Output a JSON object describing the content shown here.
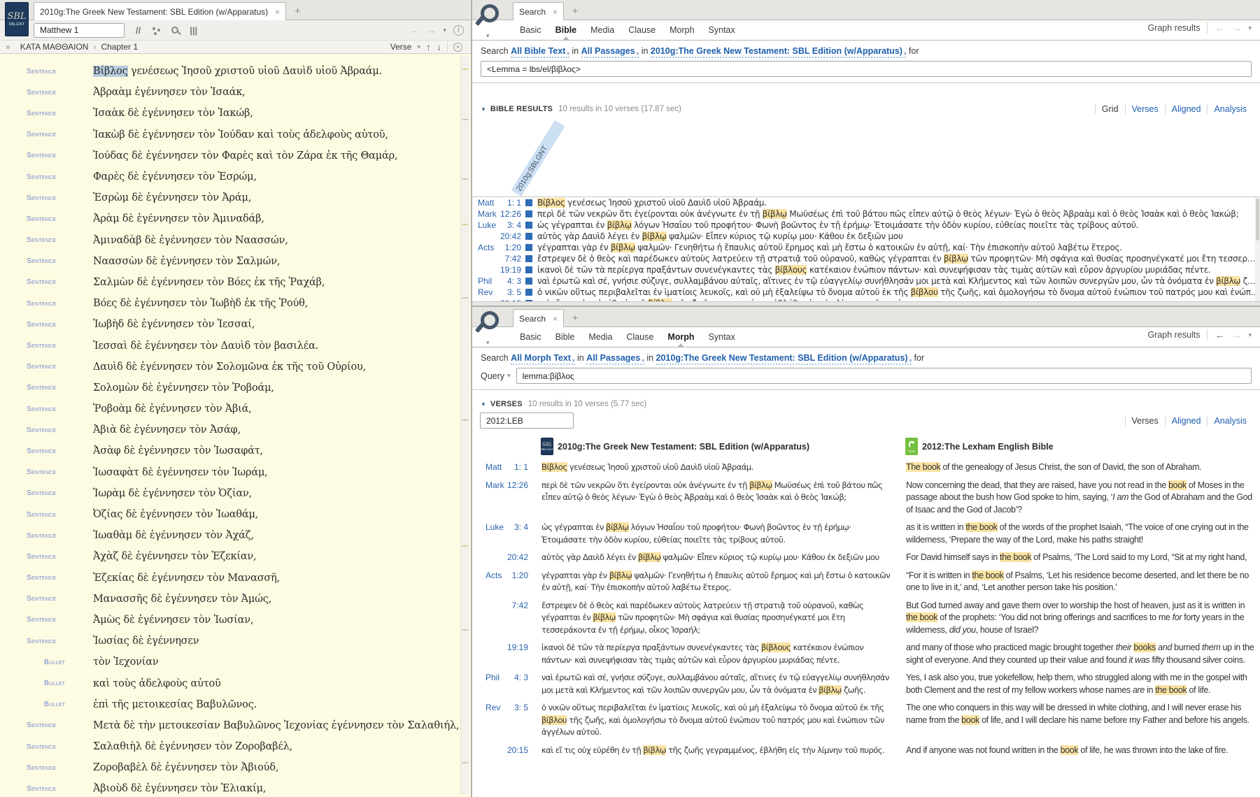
{
  "icons": {
    "close": "×",
    "add": "+",
    "caret": "▾",
    "back": "←",
    "forward": "→",
    "up": "↑",
    "down": "↓",
    "double_chevron": "»",
    "crumb": "›",
    "collapse": "▼",
    "parallel": "//",
    "columns": "|||",
    "info": "i"
  },
  "colors": {
    "hl": "#fae3a2",
    "sel": "#b7cdde",
    "link": "#1d5fad",
    "ref": "#2a62ad",
    "marker": "#2e6cb5",
    "leb": "#74bf3e",
    "navy": "#1d3a5e",
    "cream": "#fdfbe2",
    "label": "#7282cc"
  },
  "left_panel": {
    "tab_title": "2010g:The Greek New Testament: SBL Edition (w/Apparatus)",
    "logo": {
      "script": "SBL",
      "caption": "SBLGNT"
    },
    "reference_box": "Matthew 1",
    "locator": {
      "book": "ΚΑΤΑ ΜΑΘΘΑΙΟΝ",
      "chapter": "Chapter 1",
      "view_mode": "Verse"
    },
    "rows": [
      {
        "kind": "sentence",
        "label": "Sentence",
        "segments": [
          {
            "t": "Βίβλος",
            "sel": true
          },
          {
            "t": " γενέσεως Ἰησοῦ χριστοῦ υἱοῦ Δαυὶδ υἱοῦ Ἀβραάμ."
          }
        ]
      },
      {
        "kind": "sentence",
        "label": "Sentence",
        "segments": [
          {
            "t": "Ἀβραὰμ ἐγέννησεν τὸν Ἰσαάκ,"
          }
        ]
      },
      {
        "kind": "sentence",
        "label": "Sentence",
        "segments": [
          {
            "t": "Ἰσαὰκ δὲ ἐγέννησεν τὸν Ἰακώβ,"
          }
        ]
      },
      {
        "kind": "sentence",
        "label": "Sentence",
        "segments": [
          {
            "t": "Ἰακὼβ δὲ ἐγέννησεν τὸν Ἰούδαν καὶ τοὺς ἀδελφοὺς αὐτοῦ,"
          }
        ]
      },
      {
        "kind": "sentence",
        "label": "Sentence",
        "segments": [
          {
            "t": "Ἰούδας δὲ ἐγέννησεν τὸν Φαρὲς καὶ τὸν Ζάρα ἐκ τῆς Θαμάρ,"
          }
        ]
      },
      {
        "kind": "sentence",
        "label": "Sentence",
        "segments": [
          {
            "t": "Φαρὲς δὲ ἐγέννησεν τὸν Ἑσρώμ,"
          }
        ]
      },
      {
        "kind": "sentence",
        "label": "Sentence",
        "segments": [
          {
            "t": "Ἑσρὼμ δὲ ἐγέννησεν τὸν Ἀράμ,"
          }
        ]
      },
      {
        "kind": "sentence",
        "label": "Sentence",
        "segments": [
          {
            "t": "Ἀρὰμ δὲ ἐγέννησεν τὸν Ἀμιναδάβ,"
          }
        ]
      },
      {
        "kind": "sentence",
        "label": "Sentence",
        "segments": [
          {
            "t": "Ἀμιναδὰβ δὲ ἐγέννησεν τὸν Ναασσών,"
          }
        ]
      },
      {
        "kind": "sentence",
        "label": "Sentence",
        "segments": [
          {
            "t": "Ναασσὼν δὲ ἐγέννησεν τὸν Σαλμών,"
          }
        ]
      },
      {
        "kind": "sentence",
        "label": "Sentence",
        "segments": [
          {
            "t": "Σαλμὼν δὲ ἐγέννησεν τὸν Βόες ἐκ τῆς Ῥαχάβ,"
          }
        ]
      },
      {
        "kind": "sentence",
        "label": "Sentence",
        "segments": [
          {
            "t": "Βόες δὲ ἐγέννησεν τὸν Ἰωβὴδ ἐκ τῆς Ῥούθ,"
          }
        ]
      },
      {
        "kind": "sentence",
        "label": "Sentence",
        "segments": [
          {
            "t": "Ἰωβὴδ δὲ ἐγέννησεν τὸν Ἰεσσαί,"
          }
        ]
      },
      {
        "kind": "sentence",
        "label": "Sentence",
        "segments": [
          {
            "t": "Ἰεσσαὶ δὲ ἐγέννησεν τὸν Δαυὶδ τὸν βασιλέα."
          }
        ]
      },
      {
        "kind": "sentence",
        "label": "Sentence",
        "segments": [
          {
            "t": "Δαυὶδ δὲ ἐγέννησεν τὸν Σολομῶνα ἐκ τῆς τοῦ Οὐρίου,"
          }
        ]
      },
      {
        "kind": "sentence",
        "label": "Sentence",
        "segments": [
          {
            "t": "Σολομὼν δὲ ἐγέννησεν τὸν Ῥοβοάμ,"
          }
        ]
      },
      {
        "kind": "sentence",
        "label": "Sentence",
        "segments": [
          {
            "t": "Ῥοβοὰμ δὲ ἐγέννησεν τὸν Ἀβιά,"
          }
        ]
      },
      {
        "kind": "sentence",
        "label": "Sentence",
        "segments": [
          {
            "t": "Ἀβιὰ δὲ ἐγέννησεν τὸν Ἀσάφ,"
          }
        ]
      },
      {
        "kind": "sentence",
        "label": "Sentence",
        "segments": [
          {
            "t": "Ἀσὰφ δὲ ἐγέννησεν τὸν Ἰωσαφάτ,"
          }
        ]
      },
      {
        "kind": "sentence",
        "label": "Sentence",
        "segments": [
          {
            "t": "Ἰωσαφὰτ δὲ ἐγέννησεν τὸν Ἰωράμ,"
          }
        ]
      },
      {
        "kind": "sentence",
        "label": "Sentence",
        "segments": [
          {
            "t": "Ἰωρὰμ δὲ ἐγέννησεν τὸν Ὀζίαν,"
          }
        ]
      },
      {
        "kind": "sentence",
        "label": "Sentence",
        "segments": [
          {
            "t": "Ὀζίας δὲ ἐγέννησεν τὸν Ἰωαθάμ,"
          }
        ]
      },
      {
        "kind": "sentence",
        "label": "Sentence",
        "segments": [
          {
            "t": "Ἰωαθὰμ δὲ ἐγέννησεν τὸν Ἀχάζ,"
          }
        ]
      },
      {
        "kind": "sentence",
        "label": "Sentence",
        "segments": [
          {
            "t": "Ἀχὰζ δὲ ἐγέννησεν τὸν Ἑζεκίαν,"
          }
        ]
      },
      {
        "kind": "sentence",
        "label": "Sentence",
        "segments": [
          {
            "t": "Ἑζεκίας δὲ ἐγέννησεν τὸν Μανασσῆ,"
          }
        ]
      },
      {
        "kind": "sentence",
        "label": "Sentence",
        "segments": [
          {
            "t": "Μανασσῆς δὲ ἐγέννησεν τὸν Ἀμώς,"
          }
        ]
      },
      {
        "kind": "sentence",
        "label": "Sentence",
        "segments": [
          {
            "t": "Ἀμὼς δὲ ἐγέννησεν τὸν Ἰωσίαν,"
          }
        ]
      },
      {
        "kind": "sentence",
        "label": "Sentence",
        "segments": [
          {
            "t": "Ἰωσίας δὲ ἐγέννησεν"
          }
        ]
      },
      {
        "kind": "bullet",
        "label": "Bullet",
        "segments": [
          {
            "t": "τὸν Ἰεχονίαν"
          }
        ]
      },
      {
        "kind": "bullet",
        "label": "Bullet",
        "segments": [
          {
            "t": "καὶ τοὺς ἀδελφοὺς αὐτοῦ"
          }
        ]
      },
      {
        "kind": "bullet",
        "label": "Bullet",
        "segments": [
          {
            "t": "ἐπὶ τῆς μετοικεσίας Βαβυλῶνος."
          }
        ]
      },
      {
        "kind": "sentence",
        "label": "Sentence",
        "segments": [
          {
            "t": "Μετὰ δὲ τὴν μετοικεσίαν Βαβυλῶνος Ἰεχονίας ἐγέννησεν τὸν Σαλαθιήλ,"
          }
        ]
      },
      {
        "kind": "sentence",
        "label": "Sentence",
        "segments": [
          {
            "t": "Σαλαθιὴλ δὲ ἐγέννησεν τὸν Ζοροβαβέλ,"
          }
        ]
      },
      {
        "kind": "sentence",
        "label": "Sentence",
        "segments": [
          {
            "t": "Ζοροβαβὲλ δὲ ἐγέννησεν τὸν Ἀβιούδ,"
          }
        ]
      },
      {
        "kind": "sentence",
        "label": "Sentence",
        "segments": [
          {
            "t": "Ἀβιοὺδ δὲ ἐγέννησεν τὸν Ἐλιακίμ,"
          }
        ]
      }
    ]
  },
  "top_search": {
    "tab_label": "Search",
    "subtabs": [
      {
        "label": "Basic"
      },
      {
        "label": "Bible",
        "active": true
      },
      {
        "label": "Media"
      },
      {
        "label": "Clause"
      },
      {
        "label": "Morph"
      },
      {
        "label": "Syntax"
      }
    ],
    "graph_results_label": "Graph results",
    "spec": [
      {
        "t": "Search "
      },
      {
        "t": "All Bible Text",
        "link": true
      },
      {
        "t": " in "
      },
      {
        "t": "All Passages",
        "link": true
      },
      {
        "t": " in "
      },
      {
        "t": "2010g:The Greek New Testament: SBL Edition (w/Apparatus)",
        "link": true
      },
      {
        "t": " for"
      }
    ],
    "query": "<Lemma = lbs/el/βίβλος>",
    "results_label": "BIBLE RESULTS",
    "results_count": "10 results in 10 verses (17.87 sec)",
    "views": [
      {
        "label": "Grid",
        "current": true
      },
      {
        "label": "Verses"
      },
      {
        "label": "Aligned"
      },
      {
        "label": "Analysis"
      }
    ],
    "grid_column_header": "2010g:SBLGNT"
  },
  "bottom_search": {
    "tab_label": "Search",
    "subtabs": [
      {
        "label": "Basic"
      },
      {
        "label": "Bible"
      },
      {
        "label": "Media"
      },
      {
        "label": "Clause"
      },
      {
        "label": "Morph",
        "active": true
      },
      {
        "label": "Syntax"
      }
    ],
    "graph_results_label": "Graph results",
    "spec": [
      {
        "t": "Search "
      },
      {
        "t": "All Morph Text",
        "link": true
      },
      {
        "t": " in "
      },
      {
        "t": "All Passages",
        "link": true
      },
      {
        "t": " in "
      },
      {
        "t": "2010g:The Greek New Testament: SBL Edition (w/Apparatus)",
        "link": true
      },
      {
        "t": " for"
      }
    ],
    "query_label": "Query",
    "query": "lemma:βίβλος",
    "results_label": "VERSES",
    "results_count": "10 results in 10 verses (5.77 sec)",
    "version_filter": "2012:LEB",
    "views": [
      {
        "label": "Verses",
        "current": true
      },
      {
        "label": "Aligned"
      },
      {
        "label": "Analysis"
      }
    ],
    "columns": [
      {
        "title": "2010g:The Greek New Testament: SBL Edition (w/Apparatus)",
        "logo_script": "SBL",
        "logo_caption": "SBLGNT"
      },
      {
        "title": "2012:The Lexham English Bible",
        "logo_caption": "LEB"
      }
    ]
  },
  "results": [
    {
      "book": "Matt",
      "cv": "1: 1",
      "greek": [
        {
          "t": "Βίβλος",
          "h": true
        },
        {
          "t": " γενέσεως Ἰησοῦ χριστοῦ υἱοῦ Δαυὶδ υἱοῦ Ἀβραάμ."
        }
      ],
      "english": [
        {
          "t": "The book",
          "h": true
        },
        {
          "t": " of the genealogy of Jesus Christ, the son of David, the son of Abraham."
        }
      ]
    },
    {
      "book": "Mark",
      "cv": "12:26",
      "greek": [
        {
          "t": "περὶ δὲ τῶν νεκρῶν ὅτι ἐγείρονται οὐκ ἀνέγνωτε ἐν τῇ "
        },
        {
          "t": "βίβλῳ",
          "h": true
        },
        {
          "t": " Μωϋσέως ἐπὶ τοῦ βάτου πῶς εἶπεν αὐτῷ ὁ θεὸς λέγων· Ἐγὼ ὁ θεὸς Ἀβραὰμ καὶ ὁ θεὸς Ἰσαὰκ καὶ ὁ θεὸς Ἰακώβ;"
        }
      ],
      "english": [
        {
          "t": "Now concerning the dead, that they are raised, have you not read in the "
        },
        {
          "t": "book",
          "h": true
        },
        {
          "t": " of Moses in the passage about the bush how God spoke to him, saying, ‘"
        },
        {
          "t": "I am",
          "i": true
        },
        {
          "t": " the God of Abraham and the God of Isaac and the God of Jacob’?"
        }
      ]
    },
    {
      "book": "Luke",
      "cv": "3: 4",
      "greek": [
        {
          "t": "ὡς γέγραπται ἐν "
        },
        {
          "t": "βίβλῳ",
          "h": true
        },
        {
          "t": " λόγων Ἠσαΐου τοῦ προφήτου· Φωνὴ βοῶντος ἐν τῇ ἐρήμῳ· Ἑτοιμάσατε τὴν ὁδὸν κυρίου, εὐθείας ποιεῖτε τὰς τρίβους αὐτοῦ."
        }
      ],
      "english": [
        {
          "t": "as it is written in "
        },
        {
          "t": "the book",
          "h": true
        },
        {
          "t": " of the words of the prophet Isaiah, “The voice of one crying out in the wilderness, ‘Prepare the way of the Lord, make his paths straight!"
        }
      ]
    },
    {
      "book": "",
      "cv": "20:42",
      "greek": [
        {
          "t": "αὐτὸς γὰρ Δαυὶδ λέγει ἐν "
        },
        {
          "t": "βίβλῳ",
          "h": true
        },
        {
          "t": " ψαλμῶν· Εἶπεν κύριος τῷ κυρίῳ μου· Κάθου ἐκ δεξιῶν μου"
        }
      ],
      "english": [
        {
          "t": "For David himself says in "
        },
        {
          "t": "the book",
          "h": true
        },
        {
          "t": " of Psalms, ‘The Lord said to my Lord, “Sit at my right hand,"
        }
      ]
    },
    {
      "book": "Acts",
      "cv": "1:20",
      "greek": [
        {
          "t": "γέγραπται γὰρ ἐν "
        },
        {
          "t": "βίβλῳ",
          "h": true
        },
        {
          "t": " ψαλμῶν· Γενηθήτω ἡ ἔπαυλις αὐτοῦ ἔρημος καὶ μὴ ἔστω ὁ κατοικῶν ἐν αὐτῇ, καί· Τὴν ἐπισκοπὴν αὐτοῦ λαβέτω ἕτερος."
        }
      ],
      "english": [
        {
          "t": "“For it is written in "
        },
        {
          "t": "the book",
          "h": true
        },
        {
          "t": " of Psalms, ‘Let his residence become deserted, and let there be no one to live in it,’ and, ‘Let another person take his position.’"
        }
      ]
    },
    {
      "book": "",
      "cv": "7:42",
      "greek": [
        {
          "t": "ἔστρεψεν δὲ ὁ θεὸς καὶ παρέδωκεν αὐτοὺς λατρεύειν τῇ στρατιᾷ τοῦ οὐρανοῦ, καθὼς γέγραπται ἐν "
        },
        {
          "t": "βίβλῳ",
          "h": true
        },
        {
          "t": " τῶν προφητῶν· Μὴ σφάγια καὶ θυσίας προσηνέγκατέ μοι ἔτη τεσσεράκοντα ἐν τῇ ἐρήμῳ, οἶκος Ἰσραήλ;"
        }
      ],
      "english": [
        {
          "t": "But God turned away and gave them over to worship the host of heaven, just as it is written in "
        },
        {
          "t": "the book",
          "h": true
        },
        {
          "t": " of the prophets: ‘You did not bring offerings and sacrifices to me "
        },
        {
          "t": "for",
          "i": true
        },
        {
          "t": " forty years in the wilderness, "
        },
        {
          "t": "did you",
          "i": true
        },
        {
          "t": ", house of Israel?"
        }
      ]
    },
    {
      "book": "",
      "cv": "19:19",
      "greek": [
        {
          "t": "ἱκανοὶ δὲ τῶν τὰ περίεργα πραξάντων συνενέγκαντες τὰς "
        },
        {
          "t": "βίβλους",
          "h": true
        },
        {
          "t": " κατέκαιον ἐνώπιον πάντων· καὶ συνεψήφισαν τὰς τιμὰς αὐτῶν καὶ εὗρον ἀργυρίου μυριάδας πέντε."
        }
      ],
      "english": [
        {
          "t": "and many of those who practiced magic brought together "
        },
        {
          "t": "their",
          "i": true
        },
        {
          "t": " "
        },
        {
          "t": "books",
          "h": true
        },
        {
          "t": " "
        },
        {
          "t": "and",
          "i": true
        },
        {
          "t": " burned "
        },
        {
          "t": "them",
          "i": true
        },
        {
          "t": " up in the sight of everyone. And they counted up their value and found "
        },
        {
          "t": "it was",
          "i": true
        },
        {
          "t": " fifty thousand silver coins."
        }
      ]
    },
    {
      "book": "Phil",
      "cv": "4: 3",
      "greek": [
        {
          "t": "ναὶ ἐρωτῶ καὶ σέ, γνήσιε σύζυγε, συλλαμβάνου αὐταῖς, αἵτινες ἐν τῷ εὐαγγελίῳ συνήθλησάν μοι μετὰ καὶ Κλήμεντος καὶ τῶν λοιπῶν συνεργῶν μου, ὧν τὰ ὀνόματα ἐν "
        },
        {
          "t": "βίβλῳ",
          "h": true
        },
        {
          "t": " ζωῆς."
        }
      ],
      "english": [
        {
          "t": "Yes, I ask also you, true yokefellow, help them, who struggled along with me in the gospel with both Clement and the rest of my fellow workers whose names "
        },
        {
          "t": "are",
          "i": true
        },
        {
          "t": " in "
        },
        {
          "t": "the book",
          "h": true
        },
        {
          "t": " of life."
        }
      ]
    },
    {
      "book": "Rev",
      "cv": "3: 5",
      "greek": [
        {
          "t": "ὁ νικῶν οὕτως περιβαλεῖται ἐν ἱματίοις λευκοῖς, καὶ οὐ μὴ ἐξαλείψω τὸ ὄνομα αὐτοῦ ἐκ τῆς "
        },
        {
          "t": "βίβλου",
          "h": true
        },
        {
          "t": " τῆς ζωῆς, καὶ ὁμολογήσω τὸ ὄνομα αὐτοῦ ἐνώπιον τοῦ πατρός μου καὶ ἐνώπιον τῶν ἀγγέλων αὐτοῦ."
        }
      ],
      "english": [
        {
          "t": "The one who conquers in this way will be dressed in white clothing, and I will never erase his name from the "
        },
        {
          "t": "book",
          "h": true
        },
        {
          "t": " of life, and I will declare his name before my Father and before his angels."
        }
      ]
    },
    {
      "book": "",
      "cv": "20:15",
      "greek": [
        {
          "t": "καὶ εἴ τις οὐχ εὑρέθη ἐν τῇ "
        },
        {
          "t": "βίβλῳ",
          "h": true
        },
        {
          "t": " τῆς ζωῆς γεγραμμένος, ἐβλήθη εἰς τὴν λίμνην τοῦ πυρός."
        }
      ],
      "english": [
        {
          "t": "And if anyone was not found written in the "
        },
        {
          "t": "book",
          "h": true
        },
        {
          "t": " of life, he was thrown into the lake of fire."
        }
      ]
    }
  ]
}
